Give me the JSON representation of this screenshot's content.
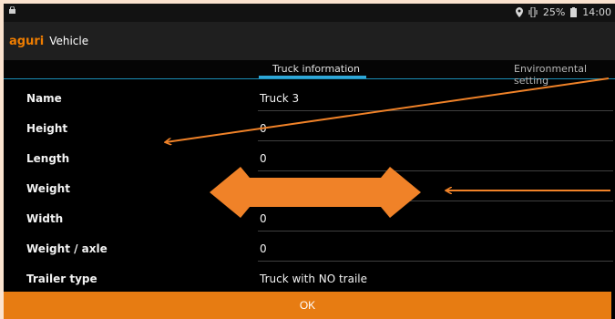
{
  "status_bar": {
    "battery": "25%",
    "time": "14:00"
  },
  "app": {
    "logo": "aguri",
    "title": "Vehicle"
  },
  "tabs": [
    {
      "label": "Truck information"
    },
    {
      "label": "Environmental setting"
    }
  ],
  "fields": [
    {
      "label": "Name",
      "value": "Truck 3"
    },
    {
      "label": "Height",
      "value": "0"
    },
    {
      "label": "Length",
      "value": "0"
    },
    {
      "label": "Weight",
      "value": ""
    },
    {
      "label": "Width",
      "value": "0"
    },
    {
      "label": "Weight / axle",
      "value": "0"
    },
    {
      "label": "Trailer type",
      "value": "Truck with NO traile"
    }
  ],
  "ok_button": {
    "label": "OK"
  },
  "colors": {
    "accent": "#ef7d00",
    "tab_indicator": "#2ea7d8",
    "ok": "#e77c12"
  }
}
